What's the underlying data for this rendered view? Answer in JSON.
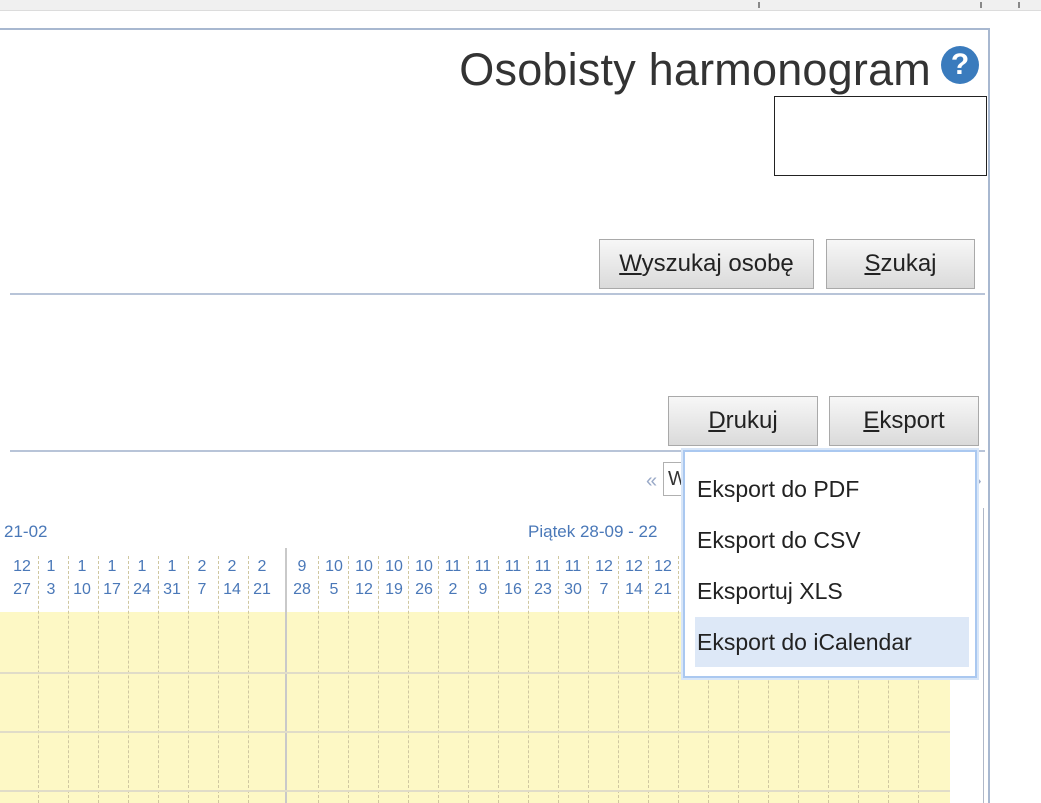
{
  "page": {
    "title": "Osobisty harmonogram",
    "help_icon": "question-mark-icon"
  },
  "toolbar1": {
    "search_person_label_underlined": "W",
    "search_person_label_rest": "yszukaj osobę",
    "search_label_underlined": "S",
    "search_label_rest": "zukaj"
  },
  "toolbar2": {
    "print_label_underlined": "D",
    "print_label_rest": "rukuj",
    "export_label_underlined": "E",
    "export_label_rest": "ksport"
  },
  "nav": {
    "prev": "«",
    "next": "›",
    "week_select_value": "W"
  },
  "ranges": {
    "left": "21-02",
    "right": "Piątek 28-09 - 22"
  },
  "header_columns": [
    {
      "top": "12",
      "bottom": "27"
    },
    {
      "top": "1",
      "bottom": "3"
    },
    {
      "top": "1",
      "bottom": "10"
    },
    {
      "top": "1",
      "bottom": "17"
    },
    {
      "top": "1",
      "bottom": "24"
    },
    {
      "top": "1",
      "bottom": "31"
    },
    {
      "top": "2",
      "bottom": "7"
    },
    {
      "top": "2",
      "bottom": "14"
    },
    {
      "top": "2",
      "bottom": "21"
    },
    {
      "top": "9",
      "bottom": "28"
    },
    {
      "top": "10",
      "bottom": "5"
    },
    {
      "top": "10",
      "bottom": "12"
    },
    {
      "top": "10",
      "bottom": "19"
    },
    {
      "top": "10",
      "bottom": "26"
    },
    {
      "top": "11",
      "bottom": "2"
    },
    {
      "top": "11",
      "bottom": "9"
    },
    {
      "top": "11",
      "bottom": "16"
    },
    {
      "top": "11",
      "bottom": "23"
    },
    {
      "top": "11",
      "bottom": "30"
    },
    {
      "top": "12",
      "bottom": "7"
    },
    {
      "top": "12",
      "bottom": "14"
    },
    {
      "top": "12",
      "bottom": "21"
    }
  ],
  "export_menu": {
    "items": [
      {
        "label": "Eksport do PDF"
      },
      {
        "label": "Eksport do CSV"
      },
      {
        "label": "Eksportuj XLS"
      },
      {
        "label": "Eksport do iCalendar"
      }
    ],
    "highlighted_index": 3
  },
  "colors": {
    "accent": "#4a78b8",
    "grid_fill": "#fdf8c5",
    "menu_highlight": "#dde8f7"
  }
}
